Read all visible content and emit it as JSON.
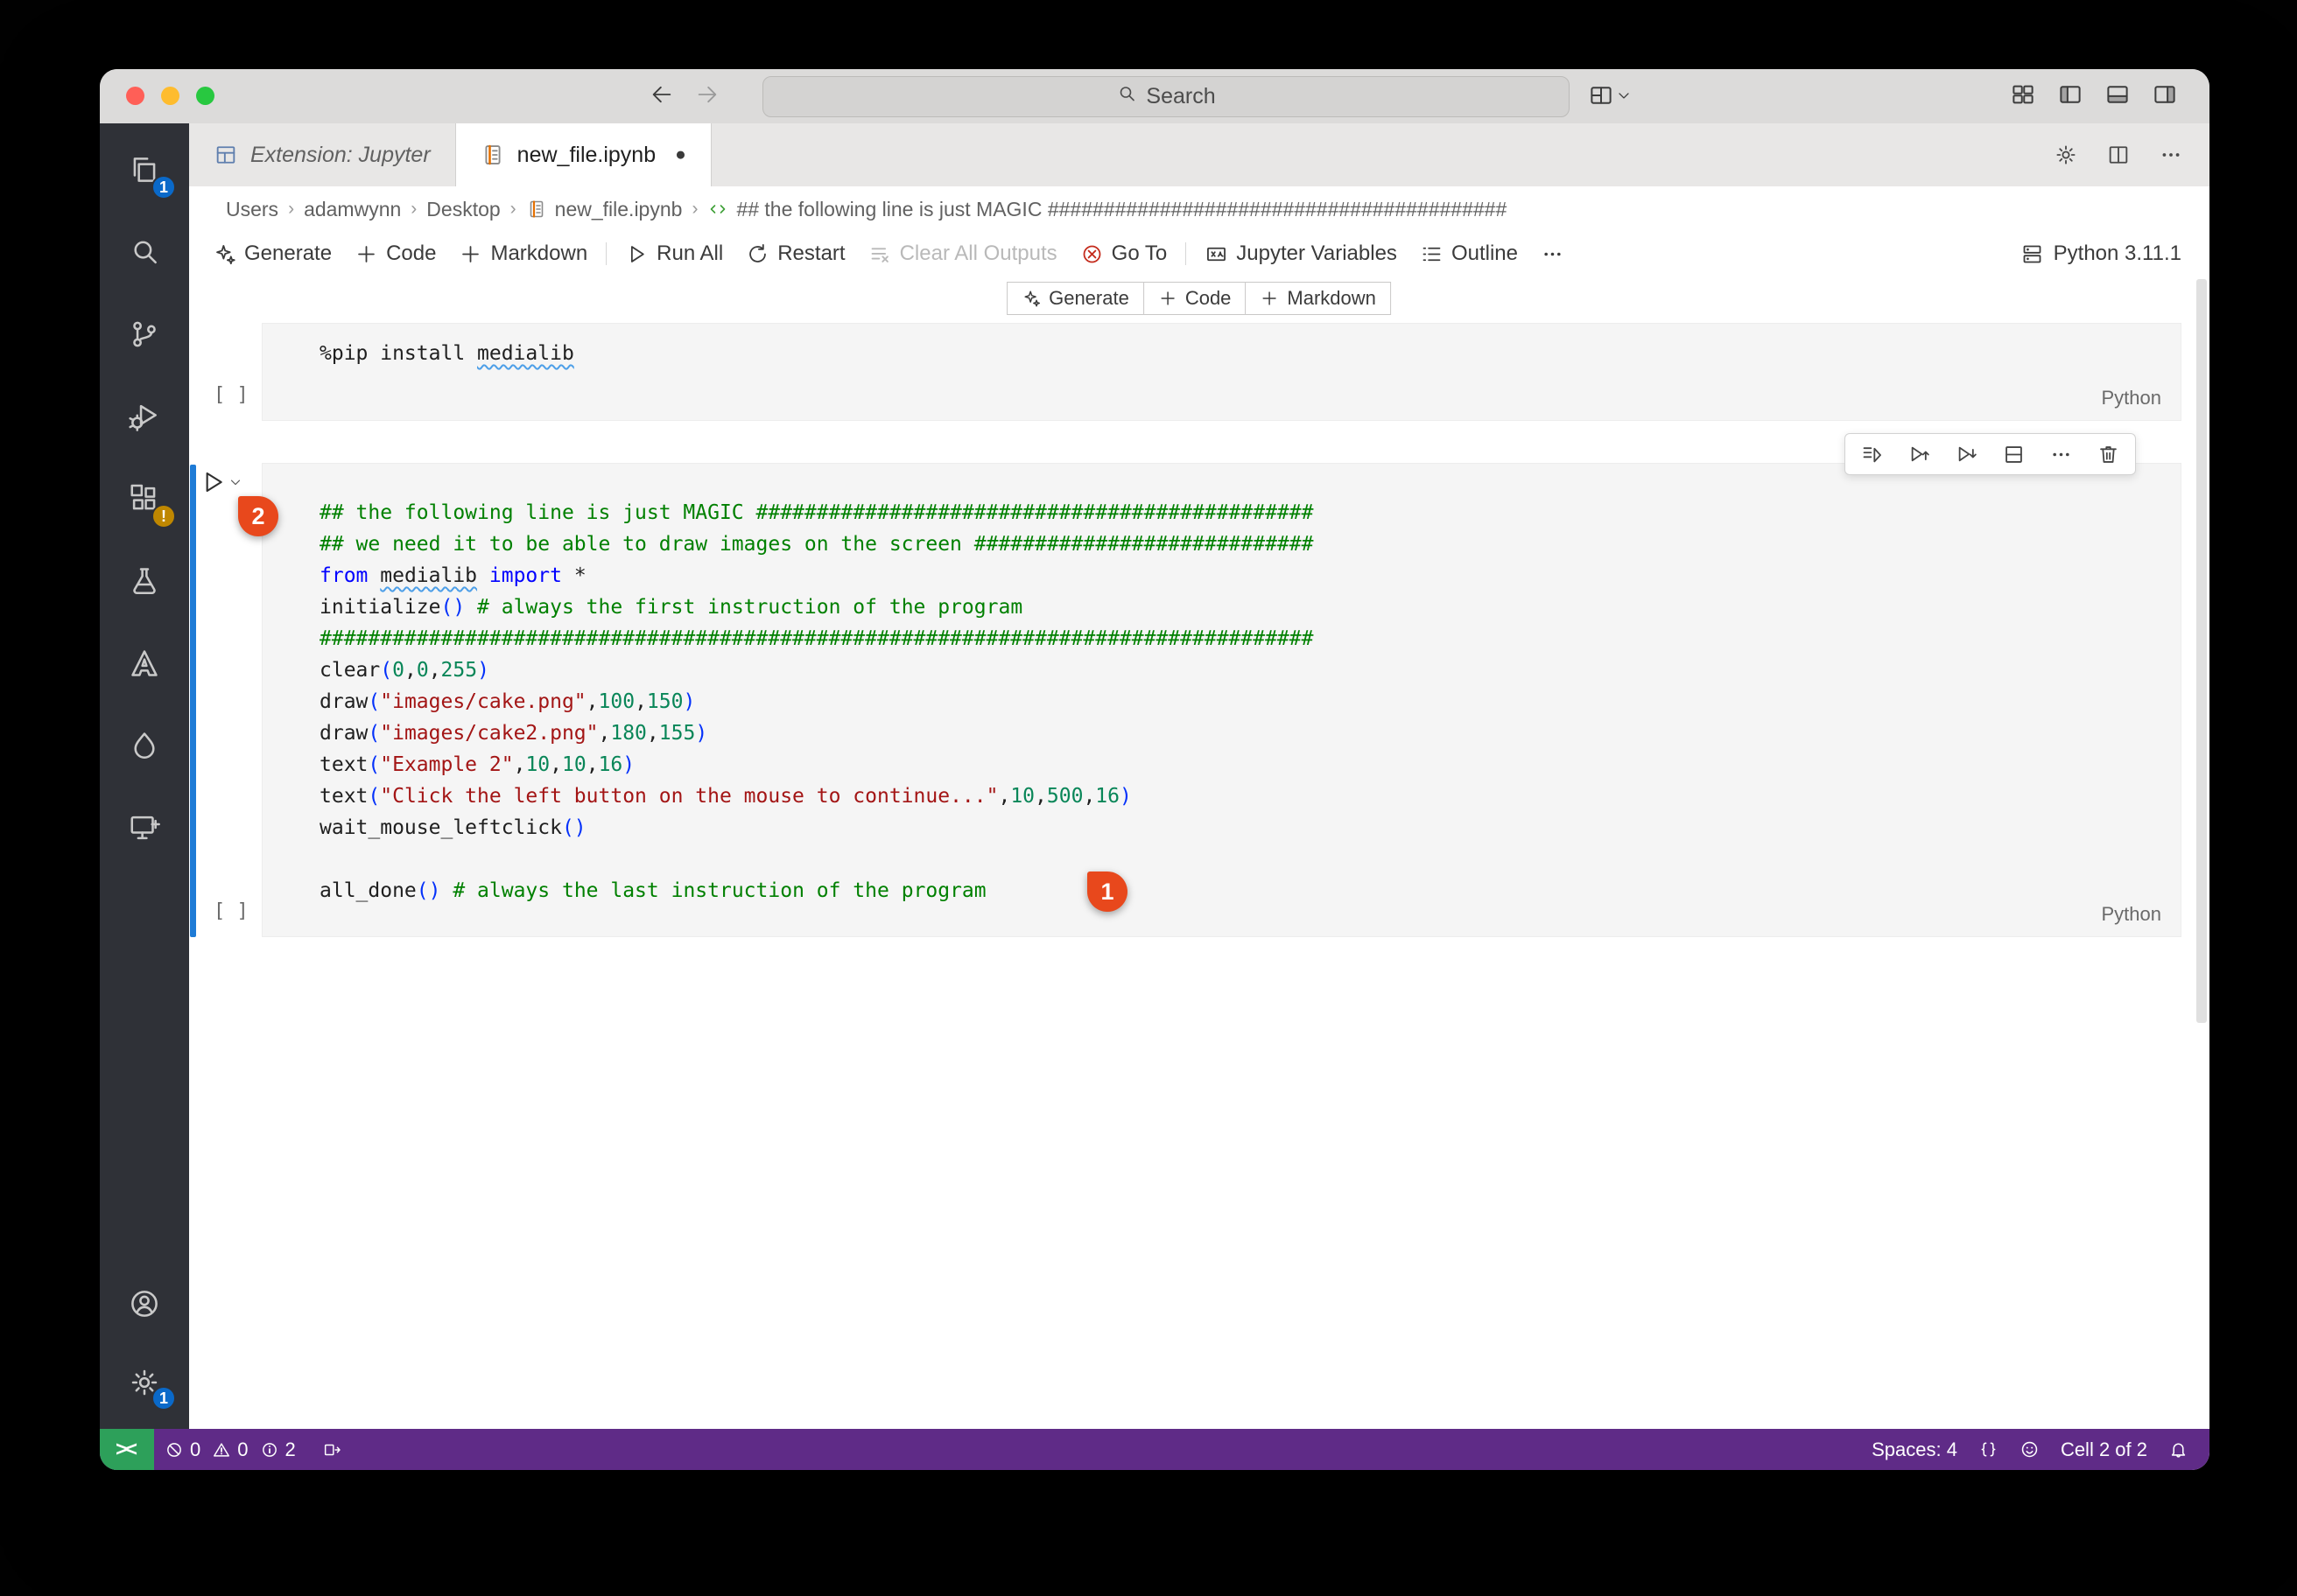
{
  "titlebar": {
    "search_placeholder": "Search"
  },
  "tabs": [
    {
      "label": "Extension: Jupyter",
      "icon": "grid-tab",
      "italic": true,
      "active": false,
      "modified": false
    },
    {
      "label": "new_file.ipynb",
      "icon": "notebook",
      "italic": false,
      "active": true,
      "modified": true
    }
  ],
  "tab_actions": [
    {
      "icon": "gear",
      "name": "configure"
    },
    {
      "icon": "split-editor",
      "name": "split-editor"
    },
    {
      "icon": "ellipsis",
      "name": "more-actions"
    }
  ],
  "breadcrumbs": [
    {
      "label": "Users"
    },
    {
      "label": "adamwynn"
    },
    {
      "label": "Desktop"
    },
    {
      "label": "new_file.ipynb",
      "icon": "notebook"
    },
    {
      "label": "## the following line is just MAGIC #########################################",
      "icon": "code-cell"
    }
  ],
  "toolbar": {
    "items": [
      {
        "icon": "sparkle",
        "label": "Generate"
      },
      {
        "icon": "plus",
        "label": "Code"
      },
      {
        "icon": "plus",
        "label": "Markdown"
      },
      {
        "divider": true
      },
      {
        "icon": "play",
        "label": "Run All"
      },
      {
        "icon": "restart",
        "label": "Restart"
      },
      {
        "icon": "clear-all",
        "label": "Clear All Outputs",
        "disabled": true
      },
      {
        "icon": "circle-slash",
        "label": "Go To",
        "icon_color": "#c42b1c"
      },
      {
        "divider": true
      },
      {
        "icon": "variables",
        "label": "Jupyter Variables"
      },
      {
        "icon": "outline",
        "label": "Outline"
      },
      {
        "icon": "ellipsis",
        "label": ""
      }
    ],
    "kernel": {
      "icon": "server",
      "label": "Python 3.11.1"
    }
  },
  "insert_toolbar": [
    {
      "icon": "sparkle",
      "label": "Generate"
    },
    {
      "icon": "plus",
      "label": "Code"
    },
    {
      "icon": "plus",
      "label": "Markdown"
    }
  ],
  "activity_bar": {
    "top": [
      {
        "name": "explorer",
        "icon": "files",
        "badge": "1"
      },
      {
        "name": "search",
        "icon": "search"
      },
      {
        "name": "source-control",
        "icon": "git"
      },
      {
        "name": "run-and-debug",
        "icon": "debug"
      },
      {
        "name": "extensions",
        "icon": "extensions",
        "badge": "!",
        "warn": true
      },
      {
        "name": "testing",
        "icon": "beaker"
      },
      {
        "name": "azure",
        "icon": "azure"
      },
      {
        "name": "extension-tool",
        "icon": "drop"
      },
      {
        "name": "remote-explorer",
        "icon": "monitor-plus"
      }
    ],
    "bottom": [
      {
        "name": "accounts",
        "icon": "account"
      },
      {
        "name": "settings",
        "icon": "gear",
        "badge": "1"
      }
    ]
  },
  "cells": [
    {
      "execution_label": "[ ]",
      "language": "Python",
      "lines": [
        [
          {
            "t": "%pip install ",
            "y": "t"
          },
          {
            "t": "medialib",
            "y": "t",
            "u": true
          }
        ]
      ]
    },
    {
      "execution_label": "[ ]",
      "language": "Python",
      "toolbar": [
        "run-list",
        "run-up",
        "run-down",
        "split-cell",
        "ellipsis",
        "trash"
      ],
      "lines": [
        [
          {
            "t": "## the following line is just MAGIC ##############################################",
            "y": "c"
          }
        ],
        [
          {
            "t": "## we need it to be able to draw images on the screen ############################",
            "y": "c"
          }
        ],
        [
          {
            "t": "from",
            "y": "k"
          },
          {
            "t": " ",
            "y": "t"
          },
          {
            "t": "medialib",
            "y": "t",
            "u": true
          },
          {
            "t": " ",
            "y": "t"
          },
          {
            "t": "import",
            "y": "k"
          },
          {
            "t": " *",
            "y": "t"
          }
        ],
        [
          {
            "t": "initialize",
            "y": "t"
          },
          {
            "t": "()",
            "y": "p"
          },
          {
            "t": " ",
            "y": "t"
          },
          {
            "t": "# always the first instruction of the program",
            "y": "c"
          }
        ],
        [
          {
            "t": "##################################################################################",
            "y": "c"
          }
        ],
        [
          {
            "t": "clear",
            "y": "t"
          },
          {
            "t": "(",
            "y": "p"
          },
          {
            "t": "0",
            "y": "n"
          },
          {
            "t": ",",
            "y": "t"
          },
          {
            "t": "0",
            "y": "n"
          },
          {
            "t": ",",
            "y": "t"
          },
          {
            "t": "255",
            "y": "n"
          },
          {
            "t": ")",
            "y": "p"
          }
        ],
        [
          {
            "t": "draw",
            "y": "t"
          },
          {
            "t": "(",
            "y": "p"
          },
          {
            "t": "\"images/cake.png\"",
            "y": "s"
          },
          {
            "t": ",",
            "y": "t"
          },
          {
            "t": "100",
            "y": "n"
          },
          {
            "t": ",",
            "y": "t"
          },
          {
            "t": "150",
            "y": "n"
          },
          {
            "t": ")",
            "y": "p"
          }
        ],
        [
          {
            "t": "draw",
            "y": "t"
          },
          {
            "t": "(",
            "y": "p"
          },
          {
            "t": "\"images/cake2.png\"",
            "y": "s"
          },
          {
            "t": ",",
            "y": "t"
          },
          {
            "t": "180",
            "y": "n"
          },
          {
            "t": ",",
            "y": "t"
          },
          {
            "t": "155",
            "y": "n"
          },
          {
            "t": ")",
            "y": "p"
          }
        ],
        [
          {
            "t": "text",
            "y": "t"
          },
          {
            "t": "(",
            "y": "p"
          },
          {
            "t": "\"Example 2\"",
            "y": "s"
          },
          {
            "t": ",",
            "y": "t"
          },
          {
            "t": "10",
            "y": "n"
          },
          {
            "t": ",",
            "y": "t"
          },
          {
            "t": "10",
            "y": "n"
          },
          {
            "t": ",",
            "y": "t"
          },
          {
            "t": "16",
            "y": "n"
          },
          {
            "t": ")",
            "y": "p"
          }
        ],
        [
          {
            "t": "text",
            "y": "t"
          },
          {
            "t": "(",
            "y": "p"
          },
          {
            "t": "\"Click the left button on the mouse to continue...\"",
            "y": "s"
          },
          {
            "t": ",",
            "y": "t"
          },
          {
            "t": "10",
            "y": "n"
          },
          {
            "t": ",",
            "y": "t"
          },
          {
            "t": "500",
            "y": "n"
          },
          {
            "t": ",",
            "y": "t"
          },
          {
            "t": "16",
            "y": "n"
          },
          {
            "t": ")",
            "y": "p"
          }
        ],
        [
          {
            "t": "wait_mouse_leftclick",
            "y": "t"
          },
          {
            "t": "()",
            "y": "p"
          }
        ],
        [],
        [
          {
            "t": "all_done",
            "y": "t"
          },
          {
            "t": "()",
            "y": "p"
          },
          {
            "t": " ",
            "y": "t"
          },
          {
            "t": "# always the last instruction of the program",
            "y": "c"
          }
        ]
      ]
    }
  ],
  "annotations": [
    {
      "label": "2"
    },
    {
      "label": "1"
    }
  ],
  "statusbar": {
    "remote_label": "><",
    "problems": {
      "errors": "0",
      "warnings": "0",
      "infos": "2"
    },
    "right": [
      {
        "label": "Spaces: 4",
        "name": "indentation"
      },
      {
        "icon": "braces",
        "name": "format"
      },
      {
        "icon": "smiley",
        "name": "feedback"
      },
      {
        "label": "Cell 2 of 2",
        "name": "cell-position"
      },
      {
        "icon": "bell",
        "name": "notifications"
      }
    ]
  },
  "colors": {
    "annotation_badge": "#e8481c",
    "cell_focus_border": "#1e7bd6",
    "statusbar_bg": "#5f2b87",
    "remote_bg": "#2da05a",
    "comment": "#008000",
    "keyword": "#0000ff",
    "string": "#a31515",
    "number": "#098658",
    "bracket": "#0431fa"
  }
}
